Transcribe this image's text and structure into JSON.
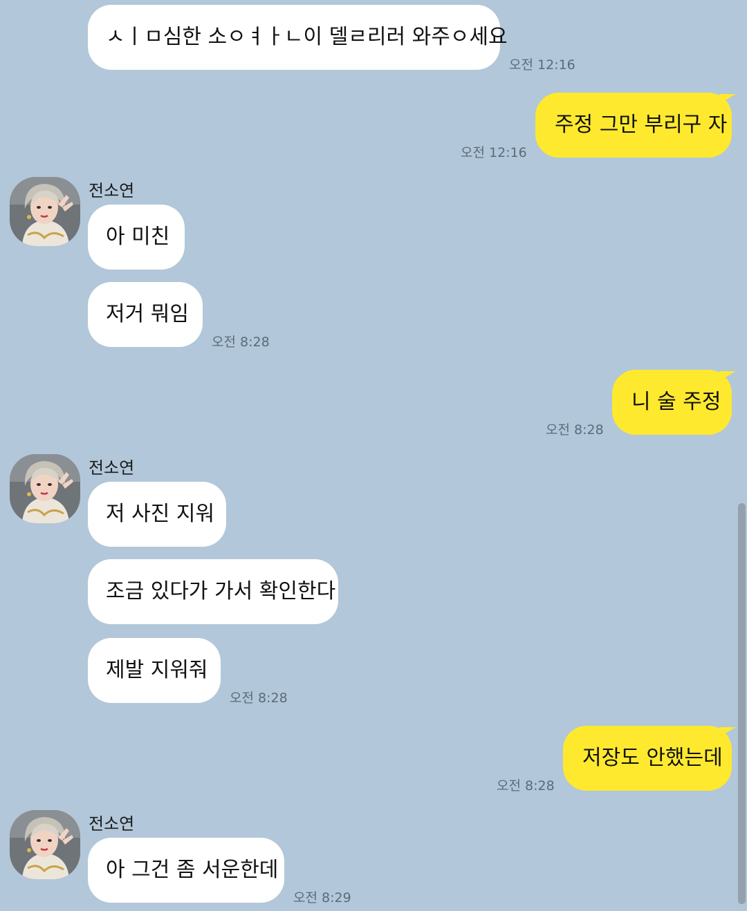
{
  "conversation": {
    "messages": [
      {
        "text": "ㅅㅣㅁ심한 소ㅇㅕㅏㄴ이 델ㄹ리러 와주ㅇ세요",
        "time": "오전 12:16"
      },
      {
        "text": "주정 그만 부리구 자",
        "time": "오전 12:16"
      },
      {
        "sender": "전소연",
        "text": "아 미친"
      },
      {
        "text": "저거 뭐임",
        "time": "오전 8:28"
      },
      {
        "text": "니 술 주정",
        "time": "오전 8:28"
      },
      {
        "sender": "전소연",
        "text": "저 사진 지워"
      },
      {
        "text": "조금 있다가 가서 확인한다"
      },
      {
        "text": "제발 지워줘",
        "time": "오전 8:28"
      },
      {
        "text": "저장도 안했는데",
        "time": "오전 8:28"
      },
      {
        "sender": "전소연",
        "text": "아 그건 좀 서운한데",
        "time": "오전 8:29"
      }
    ]
  },
  "avatar_icon": "profile-photo",
  "colors": {
    "background": "#b2c7d9",
    "incoming_bubble": "#ffffff",
    "outgoing_bubble": "#fee92f",
    "timestamp": "#5b6b78"
  }
}
